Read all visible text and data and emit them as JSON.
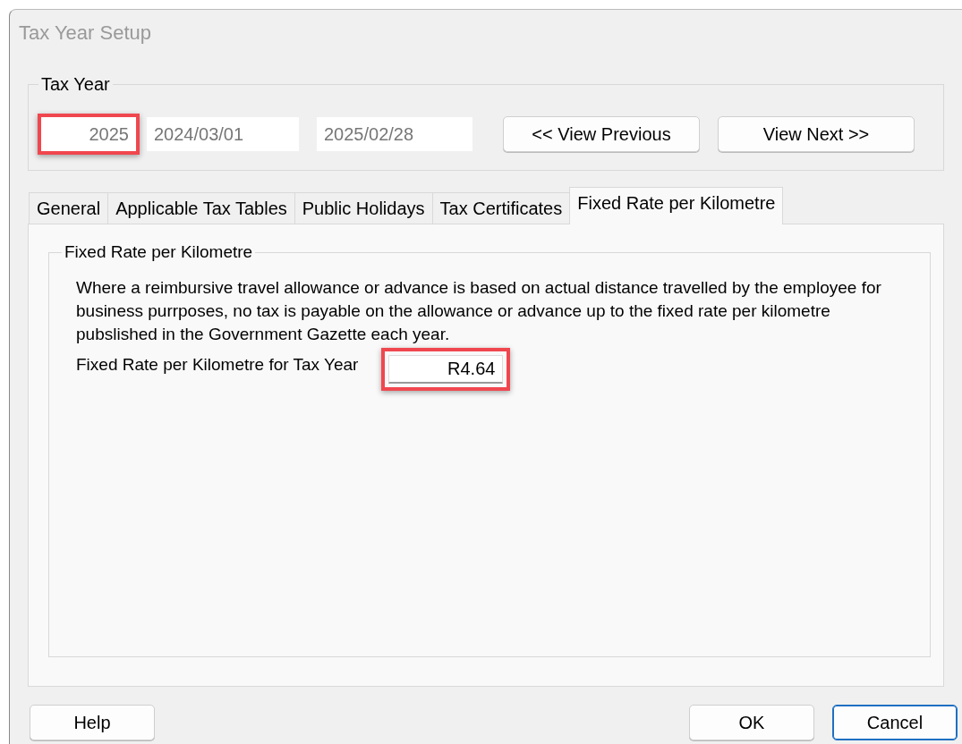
{
  "window": {
    "title": "Tax Year Setup"
  },
  "tax_year": {
    "label": "Tax Year",
    "year": "2025",
    "start": "2024/03/01",
    "end": "2025/02/28",
    "year_highlighted": true,
    "buttons": [
      {
        "label": "<<  View Previous"
      },
      {
        "label": "View Next  >>"
      }
    ]
  },
  "tabs": [
    {
      "label": "General",
      "selected": false
    },
    {
      "label": "Applicable Tax Tables",
      "selected": false
    },
    {
      "label": "Public Holidays",
      "selected": false
    },
    {
      "label": "Tax Certificates",
      "selected": false
    },
    {
      "label": "Fixed Rate per Kilometre",
      "selected": true
    }
  ],
  "panel": {
    "group_label": "Fixed Rate per Kilometre",
    "description": "Where a reimbursive travel allowance or advance is based on actual distance travelled by the employee for business purrposes, no tax is payable on the allowance or advance up to the fixed rate per kilometre pubslished in the Government Gazette each year.",
    "rate_label": "Fixed Rate per Kilometre for Tax Year",
    "rate_value": "R4.64",
    "rate_highlighted": true
  },
  "buttons": [
    {
      "label": "Help",
      "default": false
    },
    {
      "label": "OK",
      "default": false
    },
    {
      "label": "Cancel",
      "default": true
    }
  ]
}
